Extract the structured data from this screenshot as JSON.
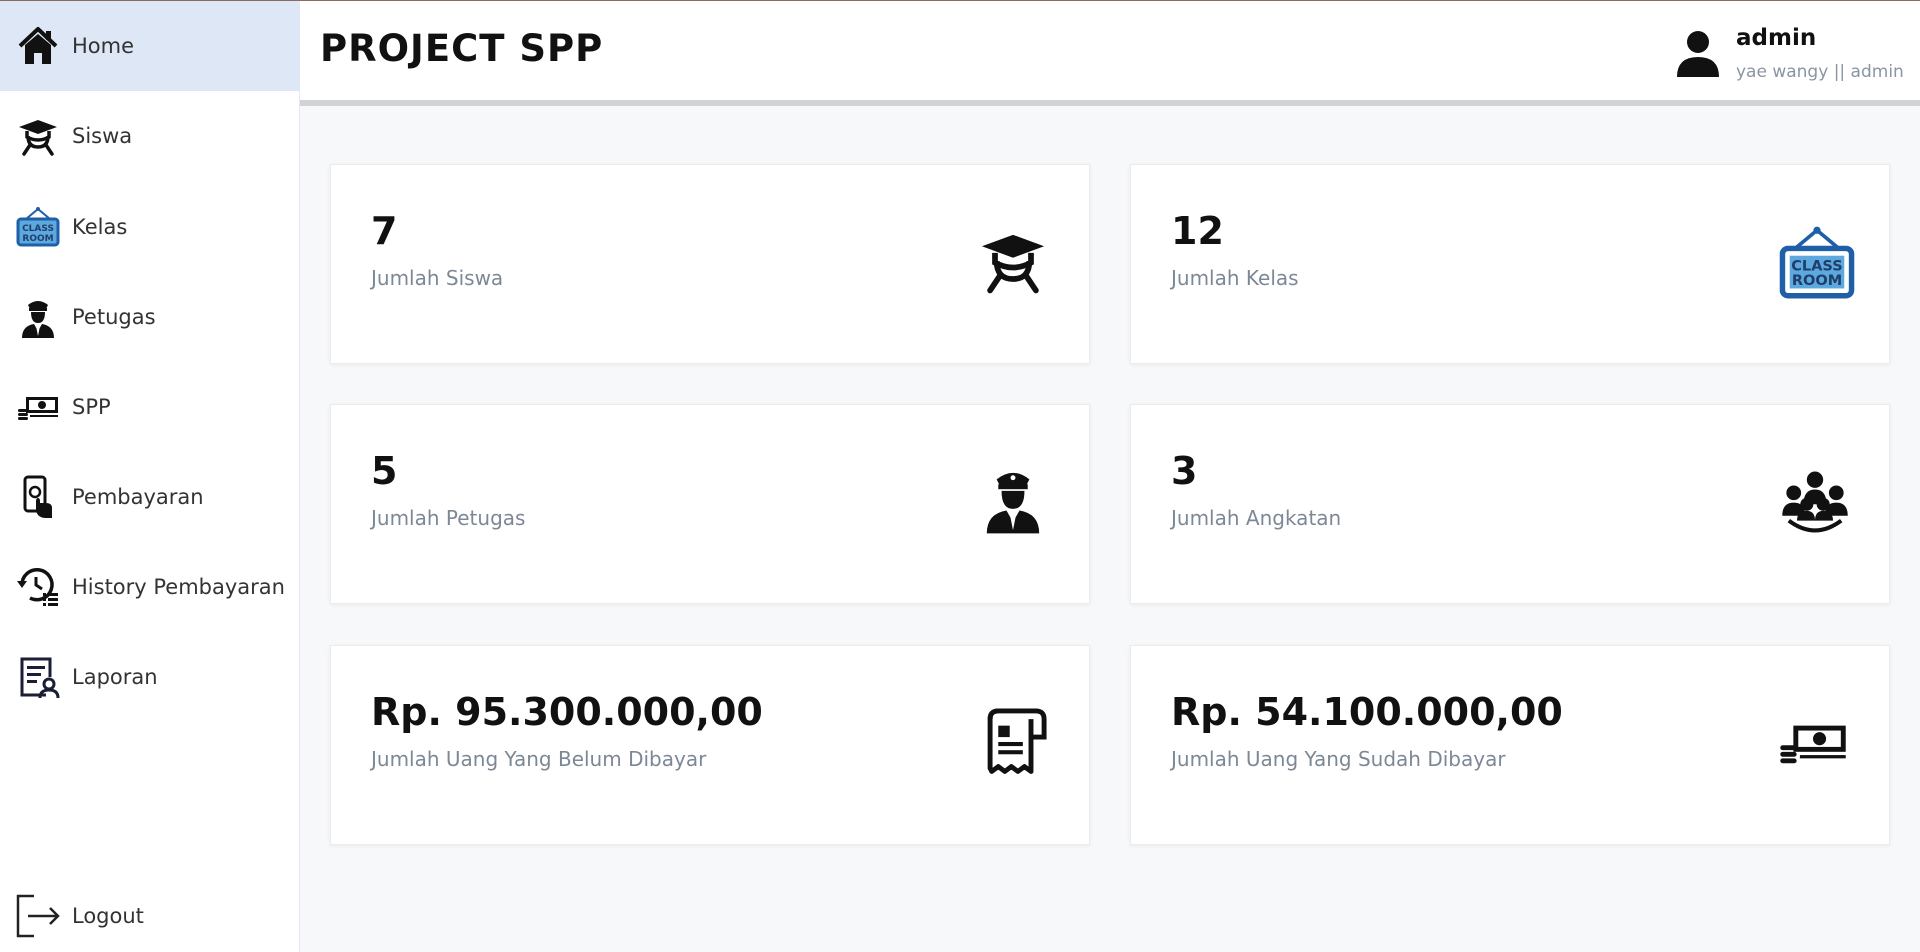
{
  "app": {
    "title": "PROJECT SPP"
  },
  "user": {
    "name": "admin",
    "subtitle": "yae wangy || admin"
  },
  "sidebar": {
    "items": [
      {
        "label": "Home",
        "icon": "home-icon",
        "active": true
      },
      {
        "label": "Siswa",
        "icon": "student-icon"
      },
      {
        "label": "Kelas",
        "icon": "classroom-icon"
      },
      {
        "label": "Petugas",
        "icon": "officer-icon"
      },
      {
        "label": "SPP",
        "icon": "money-icon"
      },
      {
        "label": "Pembayaran",
        "icon": "payment-icon"
      },
      {
        "label": "History Pembayaran",
        "icon": "history-icon"
      },
      {
        "label": "Laporan",
        "icon": "report-icon"
      }
    ],
    "logout": {
      "label": "Logout",
      "icon": "logout-icon"
    }
  },
  "cards": [
    {
      "value": "7",
      "label": "Jumlah Siswa",
      "icon": "student-icon"
    },
    {
      "value": "12",
      "label": "Jumlah Kelas",
      "icon": "classroom-icon"
    },
    {
      "value": "5",
      "label": "Jumlah Petugas",
      "icon": "officer-icon"
    },
    {
      "value": "3",
      "label": "Jumlah Angkatan",
      "icon": "group-icon"
    },
    {
      "value": "Rp. 95.300.000,00",
      "label": "Jumlah Uang Yang Belum Dibayar",
      "icon": "receipt-icon"
    },
    {
      "value": "Rp. 54.100.000,00",
      "label": "Jumlah Uang Yang Sudah Dibayar",
      "icon": "money-icon"
    }
  ],
  "colors": {
    "active_nav": "#dde7f6",
    "class_sign_blue": "#1f5fa8",
    "class_sign_fill": "#5ea8e0",
    "muted_text": "#7d8896"
  }
}
